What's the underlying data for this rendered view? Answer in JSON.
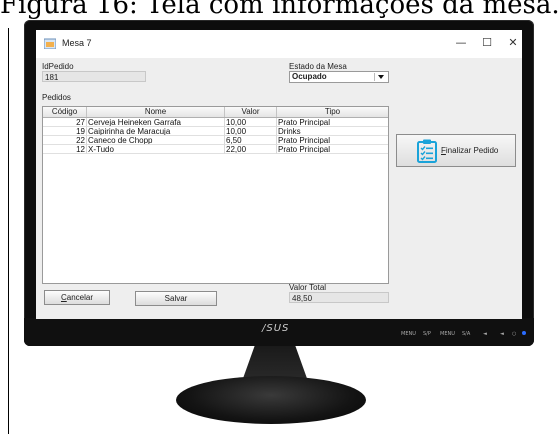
{
  "caption": "Figura 16: Tela com informações da mesa.",
  "window": {
    "title": "Mesa 7",
    "controls": {
      "minimize": "—",
      "maximize": "☐",
      "close": "✕"
    }
  },
  "form": {
    "idpedido_label": "IdPedido",
    "idpedido_value": "181",
    "estado_label": "Estado da Mesa",
    "estado_value": "Ocupado",
    "pedidos_label": "Pedidos",
    "valor_total_label": "Valor Total",
    "valor_total_value": "48,50"
  },
  "table": {
    "columns": [
      "Código",
      "Nome",
      "Valor",
      "Tipo"
    ],
    "rows": [
      [
        "27",
        "Cerveja Heineken Garrafa",
        "10,00",
        "Prato Principal"
      ],
      [
        "19",
        "Caipirinha de Maracuja",
        "10,00",
        "Drinks"
      ],
      [
        "22",
        "Caneco de Chopp",
        "6,50",
        "Prato Principal"
      ],
      [
        "12",
        "X-Tudo",
        "22,00",
        "Prato Principal"
      ]
    ]
  },
  "buttons": {
    "cancelar_first": "C",
    "cancelar_rest": "ancelar",
    "salvar": "Salvar",
    "finalizar_first": "F",
    "finalizar_rest": "inalizar Pedido"
  },
  "monitor": {
    "brand": "/SUS",
    "controls": [
      "MENU",
      "S/P",
      "MENU",
      "S/A",
      "◄",
      "◄",
      "○"
    ]
  },
  "colors": {
    "window_bg": "#eeeeee",
    "icon_blue": "#1aa3d9",
    "power_led": "#2a6cff"
  }
}
